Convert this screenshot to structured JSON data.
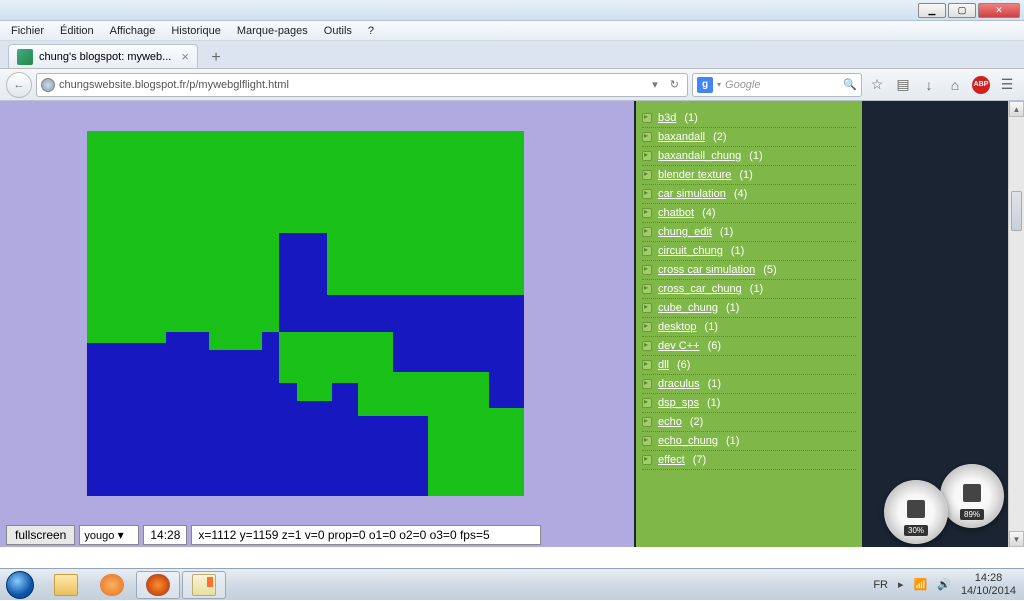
{
  "window": {
    "min": "▁",
    "max": "▢",
    "close": "✕"
  },
  "menubar": [
    "Fichier",
    "Édition",
    "Affichage",
    "Historique",
    "Marque-pages",
    "Outils",
    "?"
  ],
  "tab": {
    "title": "chung's blogspot: myweb...",
    "close": "×",
    "new": "+"
  },
  "nav": {
    "back": "←",
    "url": "chungswebsite.blogspot.fr/p/mywebglflight.html",
    "dropdown": "▾",
    "reload": "↻"
  },
  "search": {
    "engine": "g",
    "dropdown": "▾",
    "placeholder": "Google",
    "go": "🔍"
  },
  "toolbar": {
    "star": "☆",
    "list": "▤",
    "down": "↓",
    "home": "⌂",
    "menu": "☰"
  },
  "game": {
    "fullscreen": "fullscreen",
    "select": "yougo",
    "time": "14:28",
    "status": "x=1112 y=1159 z=1 v=0 prop=0 o1=0 o2=0 o3=0 fps=5"
  },
  "sidebar": [
    {
      "label": "b3d",
      "count": "(1)"
    },
    {
      "label": "baxandall",
      "count": "(2)"
    },
    {
      "label": "baxandall_chung",
      "count": "(1)"
    },
    {
      "label": "blender texture",
      "count": "(1)"
    },
    {
      "label": "car simulation",
      "count": "(4)"
    },
    {
      "label": "chatbot",
      "count": "(4)"
    },
    {
      "label": "chung_edit",
      "count": "(1)"
    },
    {
      "label": "circuit_chung",
      "count": "(1)"
    },
    {
      "label": "cross car simulation",
      "count": "(5)"
    },
    {
      "label": "cross_car_chung",
      "count": "(1)"
    },
    {
      "label": "cube_chung",
      "count": "(1)"
    },
    {
      "label": "desktop",
      "count": "(1)"
    },
    {
      "label": "dev C++",
      "count": "(6)"
    },
    {
      "label": "dll",
      "count": "(6)"
    },
    {
      "label": "draculus",
      "count": "(1)"
    },
    {
      "label": "dsp_sps",
      "count": "(1)"
    },
    {
      "label": "echo",
      "count": "(2)"
    },
    {
      "label": "echo_chung",
      "count": "(1)"
    },
    {
      "label": "effect",
      "count": "(7)"
    }
  ],
  "gadget": {
    "g1": "30%",
    "g2": "89%"
  },
  "systray": {
    "lang": "FR",
    "flag": "▸",
    "wifi": "📶",
    "vol": "🔊",
    "time": "14:28",
    "date": "14/10/2014"
  },
  "scroll": {
    "up": "▲",
    "down": "▼"
  }
}
